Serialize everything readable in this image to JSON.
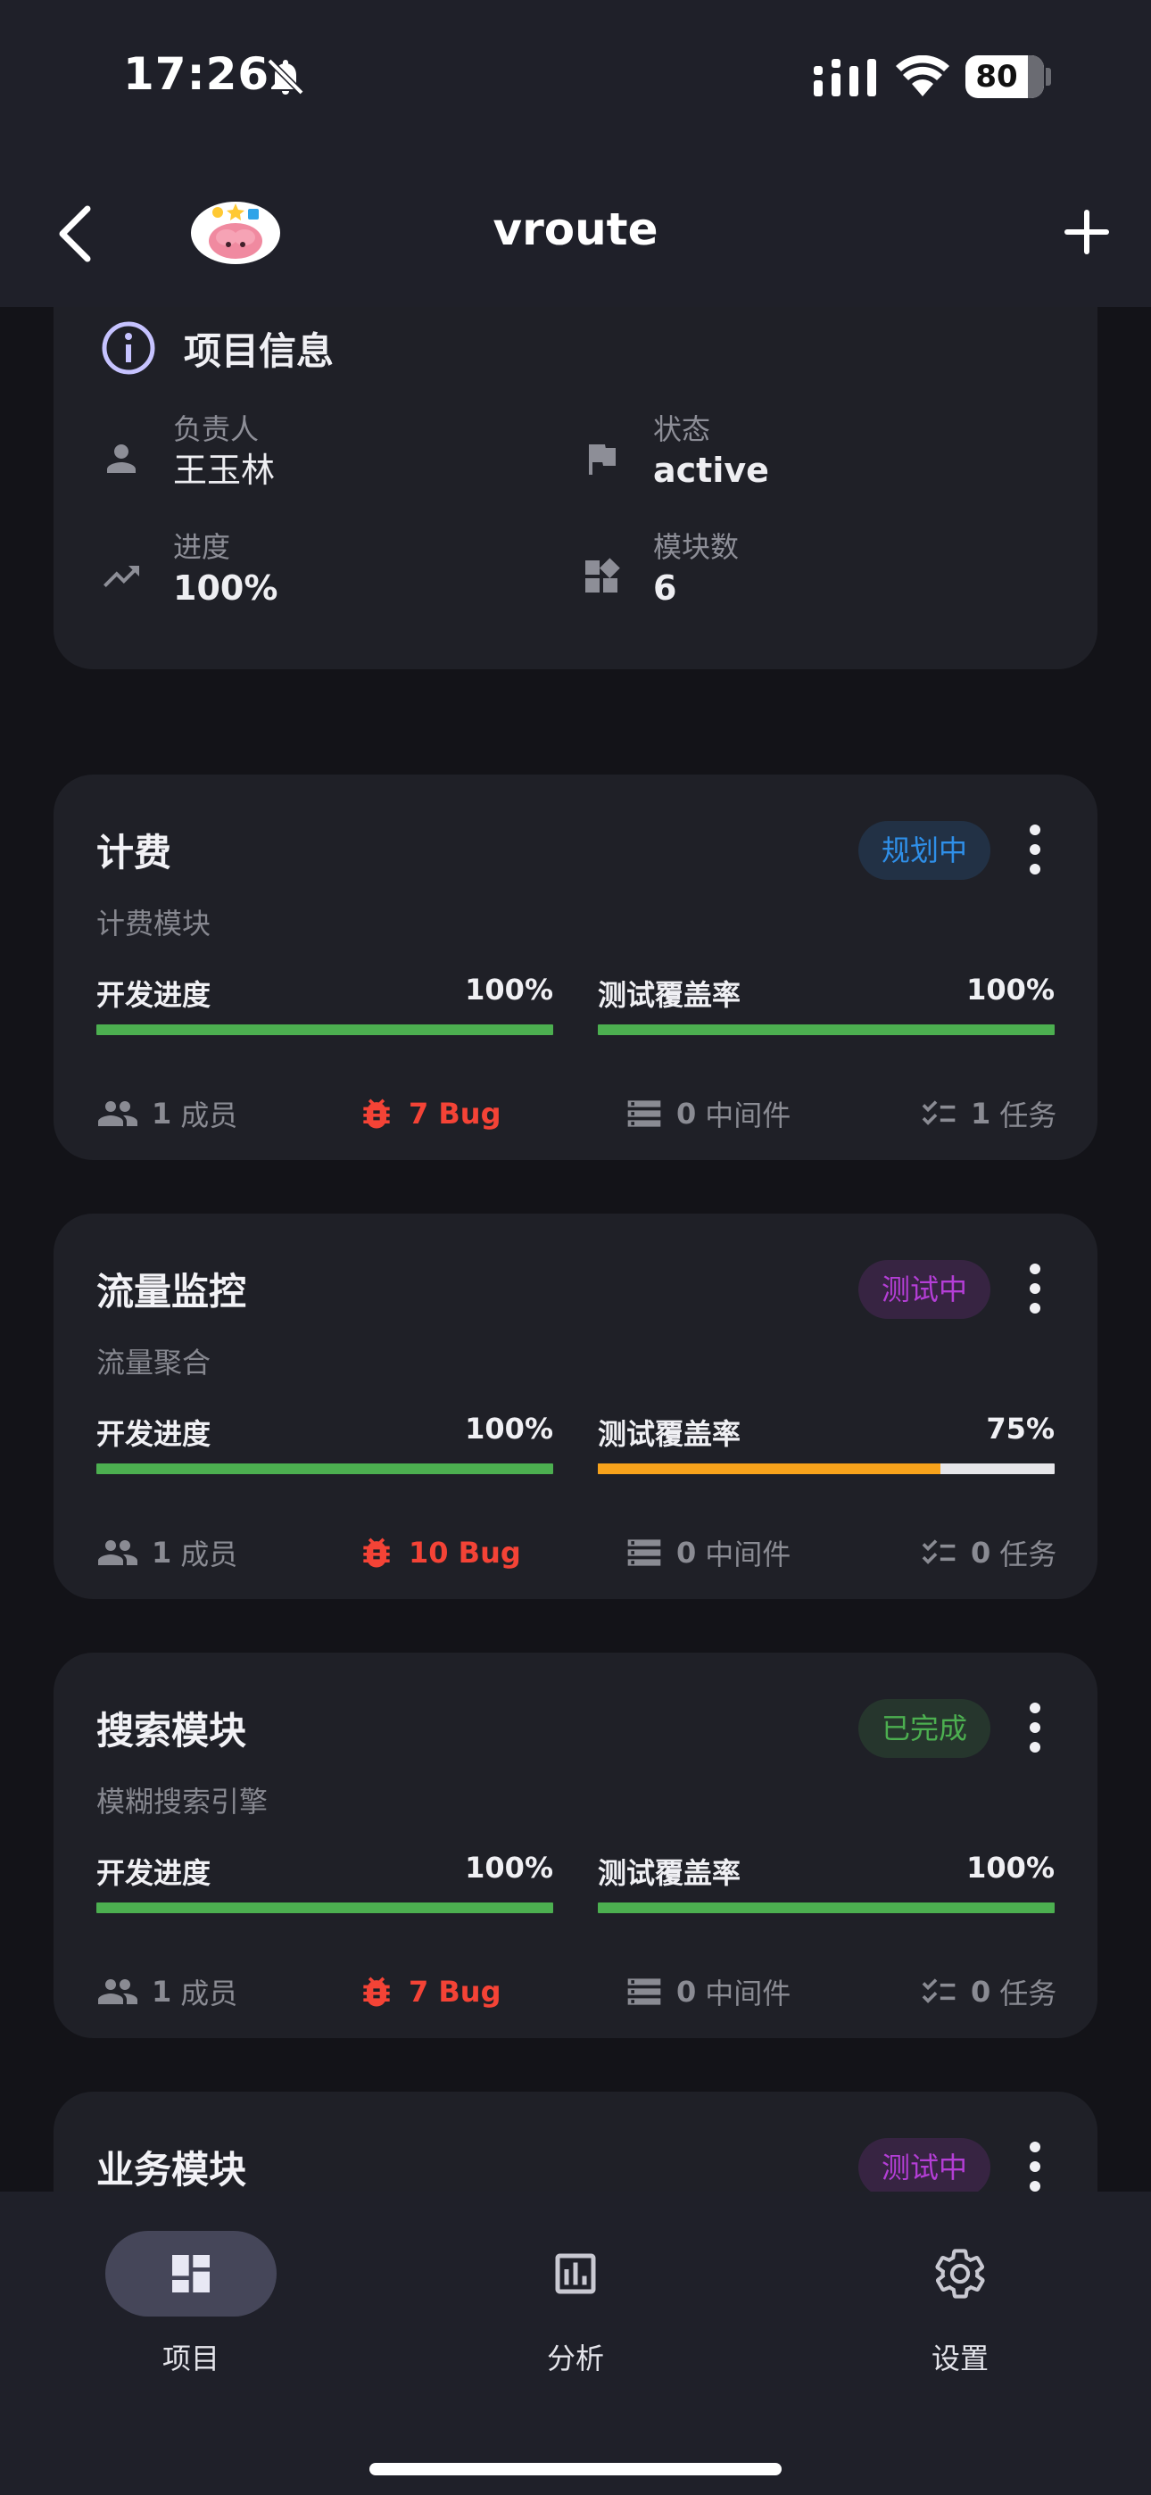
{
  "status_bar": {
    "time": "17:26",
    "battery": "80"
  },
  "header": {
    "title": "vroute"
  },
  "info": {
    "title": "项目信息",
    "owner_label": "负责人",
    "owner_value": "王玉林",
    "status_label": "状态",
    "status_value": "active",
    "progress_label": "进度",
    "progress_value": "100%",
    "modules_label": "模块数",
    "modules_value": "6"
  },
  "labels": {
    "dev_progress": "开发进度",
    "test_coverage": "测试覆盖率"
  },
  "modules": [
    {
      "name": "计费",
      "desc": "计费模块",
      "status": "规划中",
      "status_color": "#2f8fe8",
      "dev_pct": "100%",
      "dev_frac": 1.0,
      "test_pct": "100%",
      "test_frac": 1.0,
      "test_color": "#4caf50",
      "members": "1",
      "members_label": "成员",
      "bugs": "7 Bug",
      "middleware": "0",
      "middleware_label": "中间件",
      "tasks": "1",
      "tasks_label": "任务"
    },
    {
      "name": "流量监控",
      "desc": "流量聚合",
      "status": "测试中",
      "status_color": "#b43ed6",
      "dev_pct": "100%",
      "dev_frac": 1.0,
      "test_pct": "75%",
      "test_frac": 0.75,
      "test_color": "#f7a21b",
      "members": "1",
      "members_label": "成员",
      "bugs": "10 Bug",
      "middleware": "0",
      "middleware_label": "中间件",
      "tasks": "0",
      "tasks_label": "任务"
    },
    {
      "name": "搜索模块",
      "desc": "模糊搜索引擎",
      "status": "已完成",
      "status_color": "#4caf50",
      "dev_pct": "100%",
      "dev_frac": 1.0,
      "test_pct": "100%",
      "test_frac": 1.0,
      "test_color": "#4caf50",
      "members": "1",
      "members_label": "成员",
      "bugs": "7 Bug",
      "middleware": "0",
      "middleware_label": "中间件",
      "tasks": "0",
      "tasks_label": "任务"
    },
    {
      "name": "业务模块",
      "status": "测试中",
      "status_color": "#b43ed6"
    }
  ],
  "nav": {
    "projects": "项目",
    "analytics": "分析",
    "settings": "设置"
  },
  "colors": {
    "accent_green": "#4caf50",
    "bug_red": "#f44336",
    "card_bg": "#1f2027"
  }
}
